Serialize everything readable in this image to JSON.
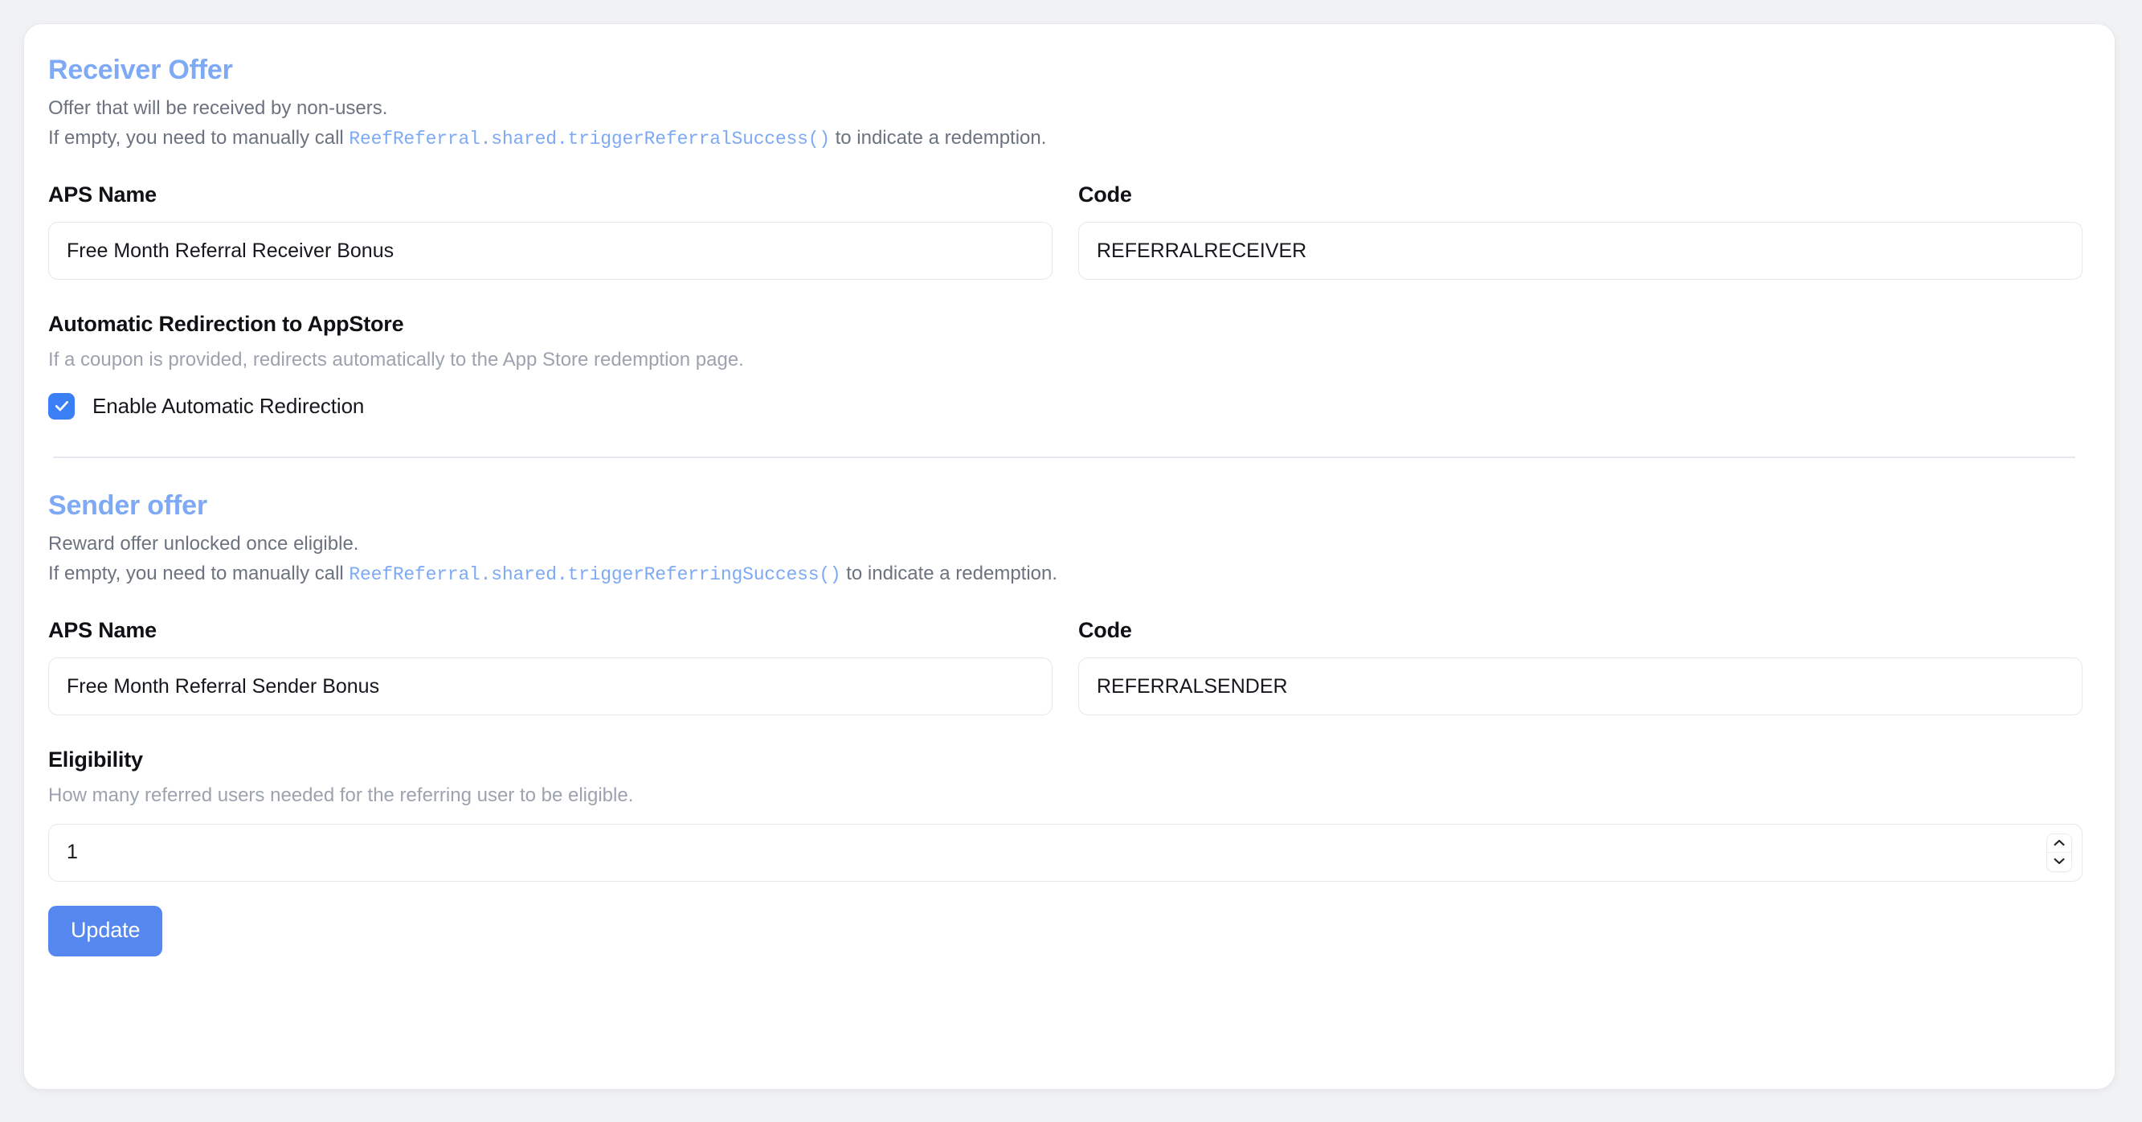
{
  "page": {
    "background_color": "#f1f2f4",
    "card_background": "#ffffff"
  },
  "colors": {
    "section_heading": "#7da9f5",
    "inline_code": "#7da9f5",
    "body_text": "#6b7280",
    "muted_text": "#9ca3af",
    "label_text": "#101114",
    "checkbox_accent": "#3b7ff5",
    "button_background": "#5687ef",
    "input_border": "#e6e7ec",
    "divider": "#e6e8ed"
  },
  "receiver_section": {
    "title": "Receiver Offer",
    "description": "Offer that will be received by non-users.",
    "call_note_prefix": "If empty, you need to manually call ",
    "call_note_code": "ReefReferral.shared.triggerReferralSuccess()",
    "call_note_suffix": " to indicate a redemption.",
    "aps_name": {
      "label": "APS Name",
      "value": "Free Month Referral Receiver Bonus",
      "placeholder": "APS Name"
    },
    "code": {
      "label": "Code",
      "value": "REFERRALRECEIVER",
      "placeholder": "Code"
    },
    "redirection": {
      "label": "Automatic Redirection to AppStore",
      "help": "If a coupon is provided, redirects automatically to the App Store redemption page.",
      "checkbox_label": "Enable Automatic Redirection",
      "checked": true,
      "check_icon": "check-icon"
    }
  },
  "sender_section": {
    "title": "Sender offer",
    "description": "Reward offer unlocked once eligible.",
    "call_note_prefix": "If empty, you need to manually call ",
    "call_note_code": "ReefReferral.shared.triggerReferringSuccess()",
    "call_note_suffix": " to indicate a redemption.",
    "aps_name": {
      "label": "APS Name",
      "value": "Free Month Referral Sender Bonus",
      "placeholder": "APS Name"
    },
    "code": {
      "label": "Code",
      "value": "REFERRALSENDER",
      "placeholder": "Code"
    },
    "eligibility": {
      "label": "Eligibility",
      "help": "How many referred users needed for the referring user to be eligible.",
      "value": "1",
      "placeholder": "1",
      "stepper_up_icon": "chevron-up-icon",
      "stepper_down_icon": "chevron-down-icon"
    }
  },
  "actions": {
    "update_label": "Update"
  }
}
